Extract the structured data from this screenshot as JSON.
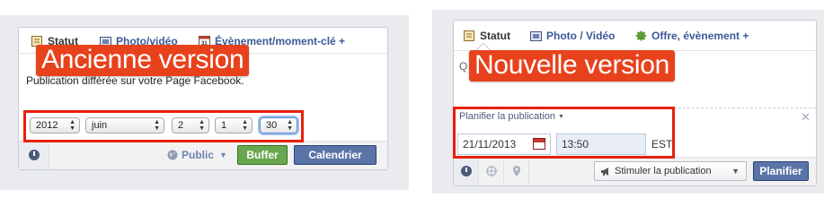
{
  "old": {
    "label": "Ancienne version",
    "tabs": [
      {
        "label": "Statut",
        "icon": "status-icon"
      },
      {
        "label": "Photo/vidéo",
        "icon": "photo-icon"
      },
      {
        "label": "Évènement/moment-clé +",
        "icon": "calendar-icon"
      }
    ],
    "composer_text": "Publication différée sur votre Page Facebook.",
    "date_selects": {
      "year": "2012",
      "month": "juin",
      "day": "2",
      "hour": "1",
      "minute": "30"
    },
    "audience_label": "Public",
    "buffer_label": "Buffer",
    "schedule_label": "Calendrier"
  },
  "new": {
    "label": "Nouvelle version",
    "tabs": [
      {
        "label": "Statut",
        "icon": "status-icon"
      },
      {
        "label": "Photo / Vidéo",
        "icon": "photo-icon"
      },
      {
        "label": "Offre, évènement +",
        "icon": "offer-icon"
      }
    ],
    "composer_placeholder": "Q",
    "schedule_title": "Planifier la publication",
    "date_value": "21/11/2013",
    "time_value": "13:50",
    "timezone": "EST",
    "boost_label": "Stimuler la publication",
    "schedule_button": "Planifier"
  },
  "colors": {
    "facebook_blue": "#3b5998",
    "annotation_red": "#e8421d",
    "buffer_green": "#69a74e"
  }
}
